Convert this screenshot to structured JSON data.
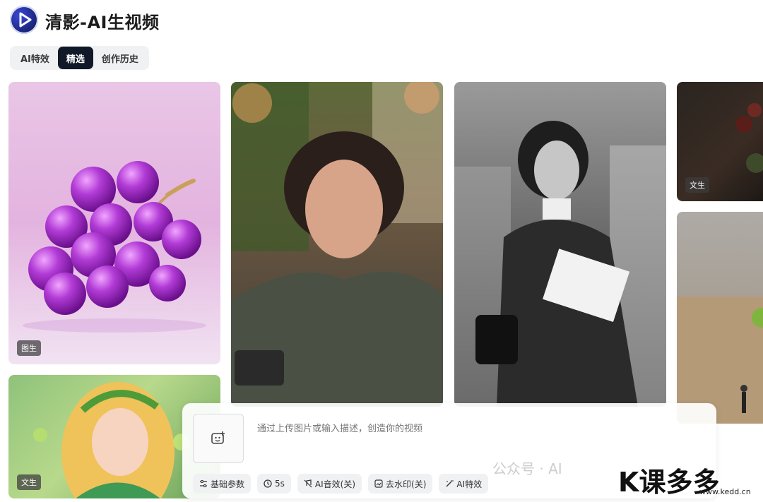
{
  "header": {
    "title": "清影-AI生视频"
  },
  "tabs": [
    {
      "label": "AI特效"
    },
    {
      "label": "精选"
    },
    {
      "label": "创作历史"
    }
  ],
  "cards": [
    {
      "badge": "图生"
    },
    {
      "badge": ""
    },
    {
      "badge": ""
    },
    {
      "badge": "文生"
    },
    {
      "badge": ""
    },
    {
      "badge": "文生"
    }
  ],
  "composer": {
    "placeholder": "通过上传图片或输入描述，创造你的视频",
    "options": [
      {
        "label": "基础参数",
        "icon": "sliders-icon"
      },
      {
        "label": "5s",
        "icon": "clock-icon"
      },
      {
        "label": "AI音效(关)",
        "icon": "music-off-icon"
      },
      {
        "label": "去水印(关)",
        "icon": "watermark-icon"
      },
      {
        "label": "AI特效",
        "icon": "magic-wand-icon"
      }
    ]
  },
  "watermark": {
    "text": "公众号 · AI",
    "brand": "K课多多",
    "site": "www.kedd.cn"
  },
  "colors": {
    "active_tab": "#111827",
    "chip_bg": "#f0f1f3",
    "brand_orange": "#ff7a00"
  }
}
